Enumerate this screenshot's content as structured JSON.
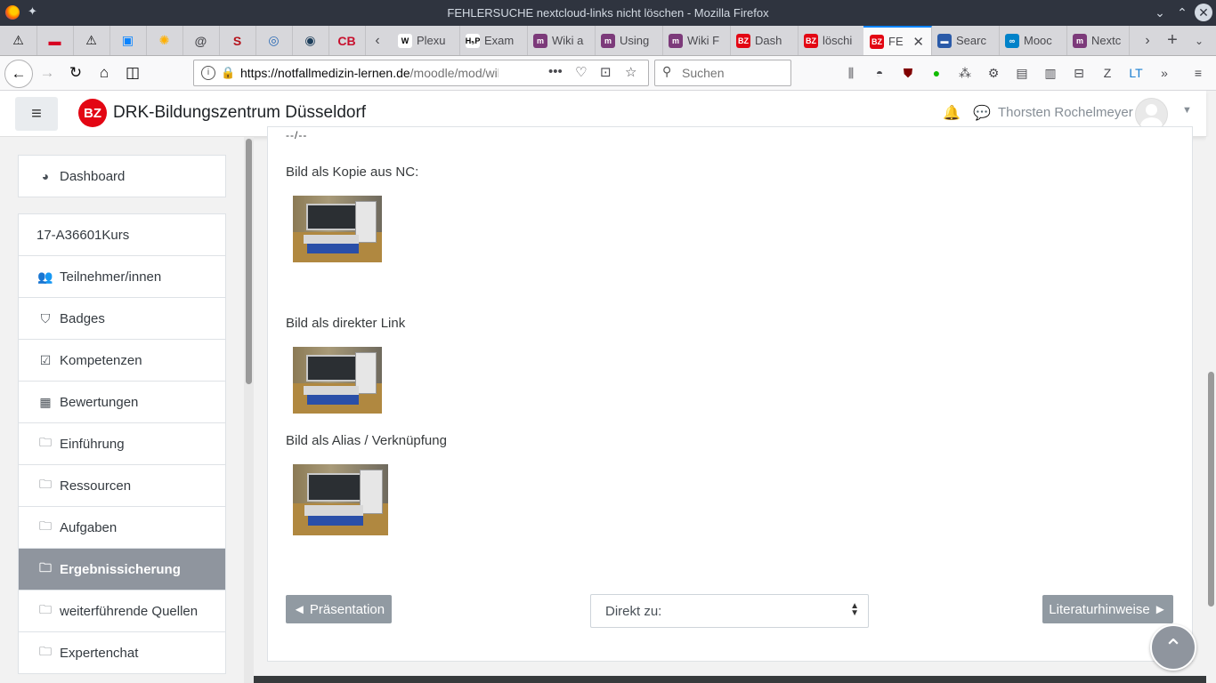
{
  "window": {
    "title": "FEHLERSUCHE nextcloud-links nicht löschen - Mozilla Firefox",
    "pin_icon": "✦",
    "buttons": [
      "⌄",
      "⌃",
      "✕"
    ]
  },
  "tabs": {
    "pinned": [
      {
        "name": "pinned-alert-1",
        "glyph": "⚠",
        "color": "#0c0c0d"
      },
      {
        "name": "pinned-red-site",
        "glyph": "▬",
        "color": "#d70022"
      },
      {
        "name": "pinned-alert-2",
        "glyph": "⚠",
        "color": "#0c0c0d"
      },
      {
        "name": "pinned-window",
        "glyph": "▣",
        "color": "#0a84ff"
      },
      {
        "name": "pinned-sun",
        "glyph": "✺",
        "color": "#ffb000"
      },
      {
        "name": "pinned-at",
        "glyph": "@",
        "color": "#4a4a4f"
      },
      {
        "name": "pinned-s",
        "glyph": "S",
        "color": "#b5121b"
      },
      {
        "name": "pinned-doc",
        "glyph": "◎",
        "color": "#2a6ab5"
      },
      {
        "name": "pinned-globe",
        "glyph": "◉",
        "color": "#1c3d5a"
      },
      {
        "name": "pinned-cb",
        "glyph": "CB",
        "color": "#c8102e"
      }
    ],
    "list": [
      {
        "label": "Plexu",
        "icon": "W",
        "color": "#ffffff",
        "fg": "#000000"
      },
      {
        "label": "Exam",
        "icon": "H₅P",
        "color": "#ffffff",
        "fg": "#000000"
      },
      {
        "label": "Wiki a",
        "icon": "m",
        "color": "#7c3a7a",
        "fg": "#ffffff"
      },
      {
        "label": "Using",
        "icon": "m",
        "color": "#7c3a7a",
        "fg": "#ffffff"
      },
      {
        "label": "Wiki F",
        "icon": "m",
        "color": "#7c3a7a",
        "fg": "#ffffff"
      },
      {
        "label": "Dash",
        "icon": "BZ",
        "color": "#e30613",
        "fg": "#ffffff"
      },
      {
        "label": "löschi",
        "icon": "BZ",
        "color": "#e30613",
        "fg": "#ffffff"
      },
      {
        "label": "FE",
        "icon": "BZ",
        "color": "#e30613",
        "fg": "#ffffff",
        "active": true
      },
      {
        "label": "Searc",
        "icon": "▬",
        "color": "#2a5aa8",
        "fg": "#ffffff"
      },
      {
        "label": "Mooc",
        "icon": "∞",
        "color": "#0082c9",
        "fg": "#ffffff"
      },
      {
        "label": "Nextc",
        "icon": "m",
        "color": "#7c3a7a",
        "fg": "#ffffff"
      }
    ],
    "close_icon": "✕"
  },
  "nav": {
    "url_host": "https://notfallmedizin-lernen.de",
    "url_path": "/moodle/mod/wiki",
    "search_placeholder": "Suchen"
  },
  "moodle": {
    "site_name": "DRK-Bildungszentrum Düsseldorf",
    "logo_text": "BZ",
    "user_name": "Thorsten Rochelmeyer",
    "sidebar": [
      {
        "label": "Dashboard",
        "icon": "◕",
        "group": 1
      },
      {
        "label": "17-A36601Kurs",
        "icon": "",
        "group": 2
      },
      {
        "label": "Teilnehmer/innen",
        "icon": "👥",
        "group": 2
      },
      {
        "label": "Badges",
        "icon": "⛉",
        "group": 2
      },
      {
        "label": "Kompetenzen",
        "icon": "☑",
        "group": 2
      },
      {
        "label": "Bewertungen",
        "icon": "▦",
        "group": 2
      },
      {
        "label": "Einführung",
        "icon": "🗀",
        "group": 2
      },
      {
        "label": "Ressourcen",
        "icon": "🗀",
        "group": 2
      },
      {
        "label": "Aufgaben",
        "icon": "🗀",
        "group": 2
      },
      {
        "label": "Ergebnissicherung",
        "icon": "🗀",
        "group": 2,
        "active": true
      },
      {
        "label": "weiterführende Quellen",
        "icon": "🗀",
        "group": 2
      },
      {
        "label": "Expertenchat",
        "icon": "🗀",
        "group": 2
      }
    ],
    "content": {
      "cut_text": "--/--",
      "section1": "Bild als Kopie aus NC:",
      "section2": "Bild als direkter Link",
      "section3": "Bild als Alias / Verknüpfung",
      "prev_button": "◄ Präsentation",
      "jump_label": "Direkt zu:",
      "next_button": "Literaturhinweise ►"
    }
  }
}
